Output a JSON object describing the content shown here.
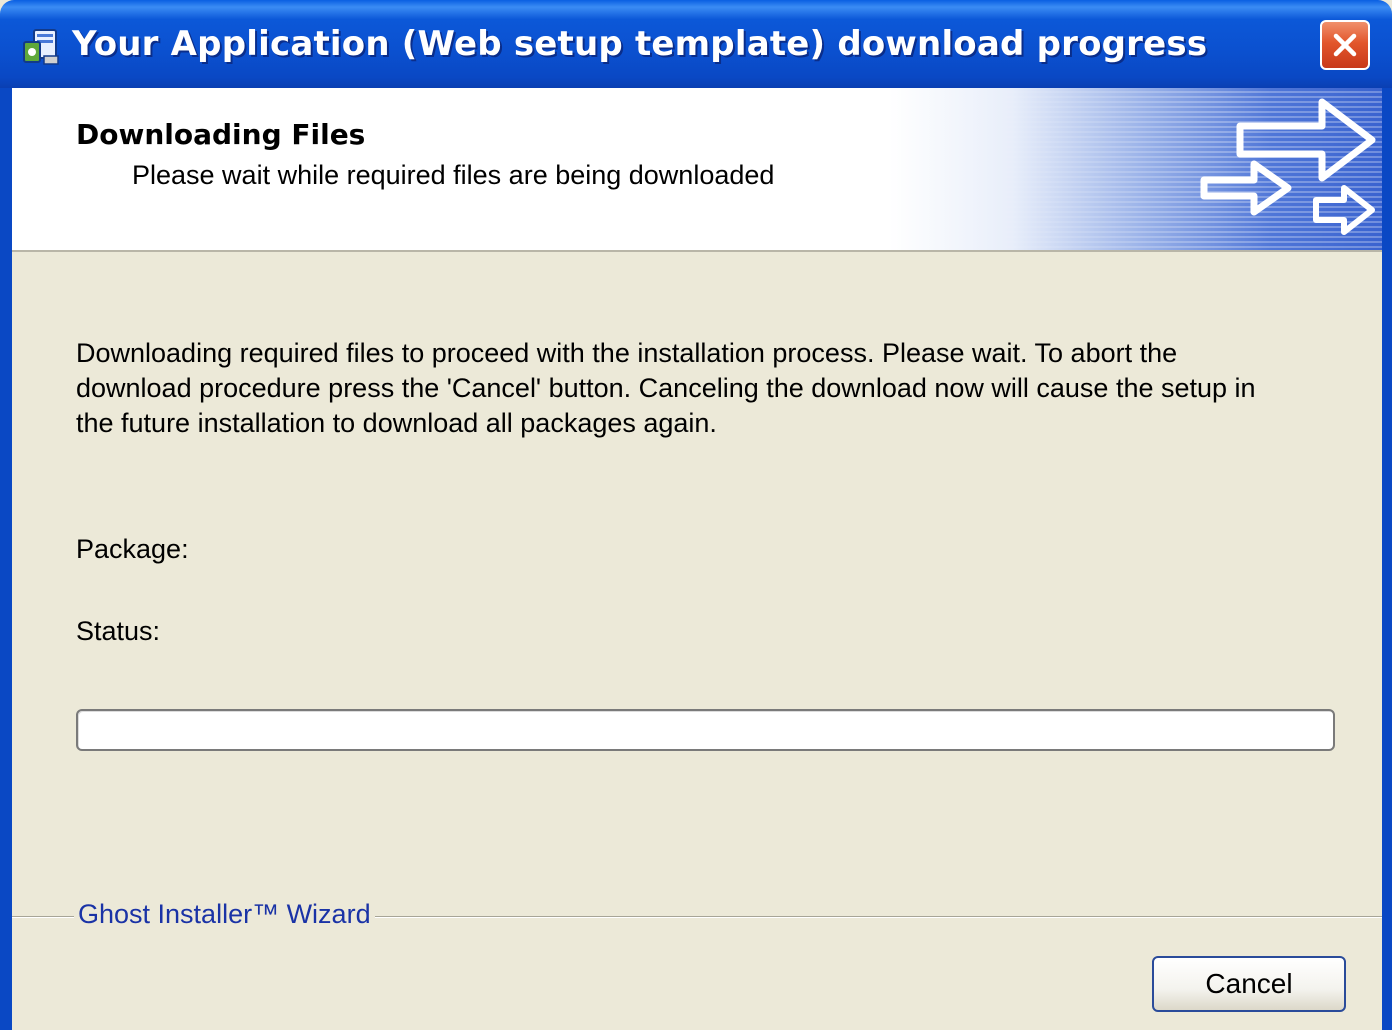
{
  "window": {
    "title": "Your Application (Web setup template) download progress",
    "close_icon": "close-x-icon",
    "app_icon": "setup-installer-icon"
  },
  "header": {
    "title": "Downloading Files",
    "subtitle": "Please wait while required files are being downloaded",
    "graphic": "arrows-graphic"
  },
  "body": {
    "lines": [
      "Downloading required files to proceed with the installation process. Please wait. To abort the",
      "download procedure press the 'Cancel' button. Canceling the download now will cause the setup in",
      "the future installation to download all packages again."
    ],
    "package_label": "Package:",
    "status_label": "Status:",
    "progress_fraction": 0
  },
  "footer": {
    "brand": "Ghost Installer™ Wizard",
    "cancel_label": "Cancel"
  },
  "colors": {
    "titlebar_blue": "#0a50cf",
    "face": "#ece9d8",
    "brand_text": "#1a33a6",
    "close_red": "#e2562c"
  }
}
